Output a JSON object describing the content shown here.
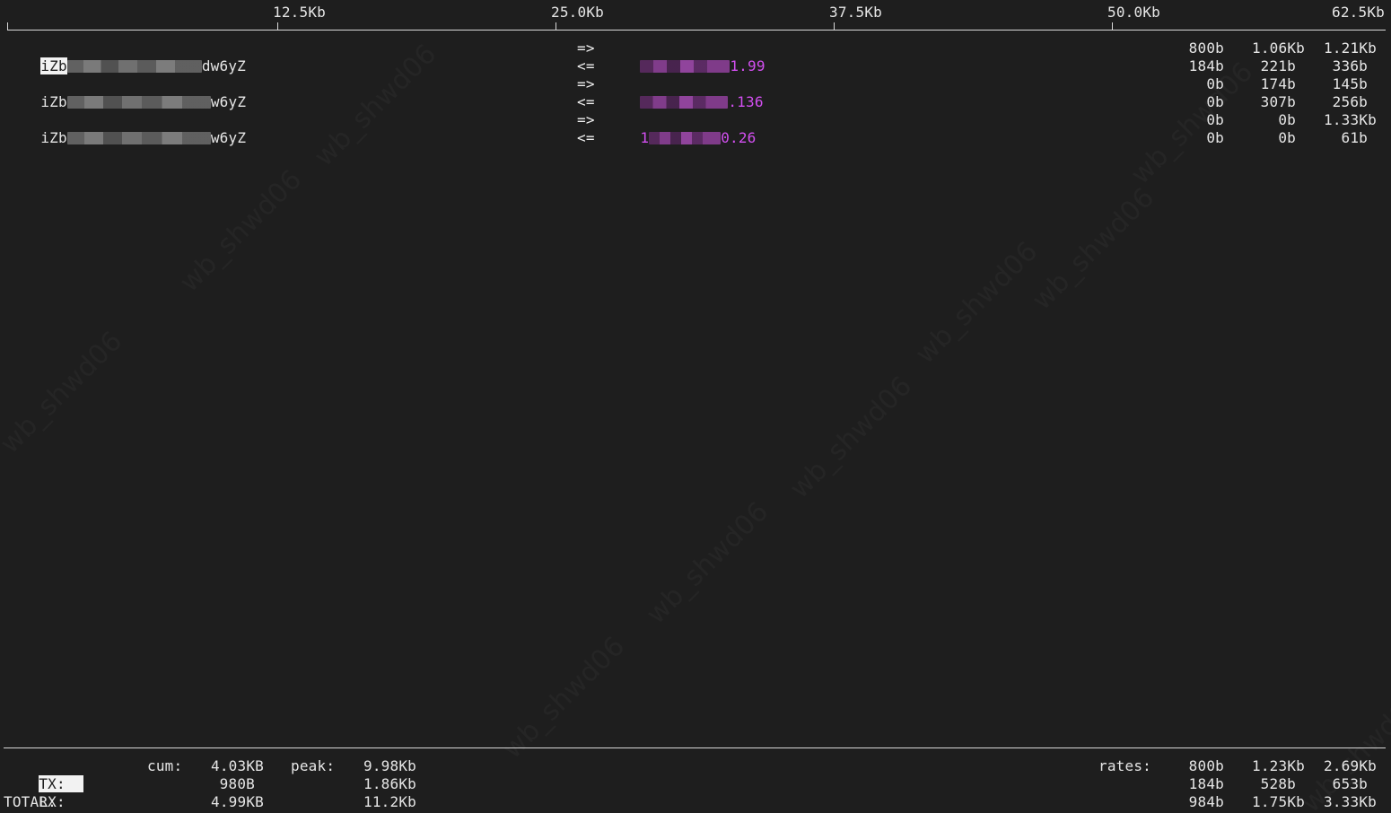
{
  "scale": {
    "ticks": [
      "12.5Kb",
      "25.0Kb",
      "37.5Kb",
      "50.0Kb",
      "62.5Kb"
    ]
  },
  "hosts": [
    {
      "prefix": "iZb",
      "suffix": "dw6yZ",
      "peer_suffix": "1.99",
      "tx": {
        "arrow": "=>",
        "r2s": "800b",
        "r10s": "1.06Kb",
        "r40s": "1.21Kb"
      },
      "rx": {
        "arrow": "<=",
        "r2s": "184b",
        "r10s": "221b",
        "r40s": "336b"
      }
    },
    {
      "prefix": "iZb",
      "suffix": "w6yZ",
      "peer_suffix": ".136",
      "tx": {
        "arrow": "=>",
        "r2s": "0b",
        "r10s": "174b",
        "r40s": "145b"
      },
      "rx": {
        "arrow": "<=",
        "r2s": "0b",
        "r10s": "307b",
        "r40s": "256b"
      }
    },
    {
      "prefix": "iZb",
      "suffix": "w6yZ",
      "peer_prefix": "1",
      "peer_suffix": "0.26",
      "tx": {
        "arrow": "=>",
        "r2s": "0b",
        "r10s": "0b",
        "r40s": "1.33Kb"
      },
      "rx": {
        "arrow": "<=",
        "r2s": "0b",
        "r10s": "0b",
        "r40s": "61b"
      }
    }
  ],
  "footer": {
    "tx_label": "TX:",
    "rx_label": "RX:",
    "total_label": "TOTAL:",
    "cum_label": "cum:",
    "peak_label": "peak:",
    "rates_label": "rates:",
    "tx": {
      "cum": "4.03KB",
      "peak": "9.98Kb",
      "r2s": "800b",
      "r10s": "1.23Kb",
      "r40s": "2.69Kb"
    },
    "rx": {
      "cum": "980B",
      "peak": "1.86Kb",
      "r2s": "184b",
      "r10s": "528b",
      "r40s": "653b"
    },
    "total": {
      "cum": "4.99KB",
      "peak": "11.2Kb",
      "r2s": "984b",
      "r10s": "1.75Kb",
      "r40s": "3.33Kb"
    }
  },
  "watermark": "wb_shwd06",
  "colors": {
    "background": "#1e1e1e",
    "text": "#e6e6e6",
    "peer_accent": "#d24ff0"
  }
}
